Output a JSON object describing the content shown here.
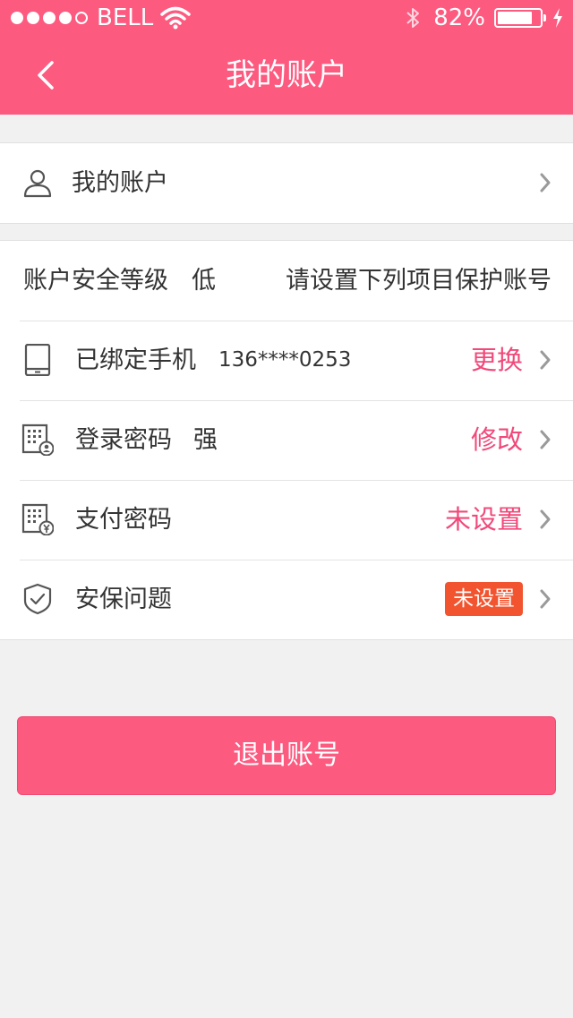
{
  "status_bar": {
    "carrier": "BELL",
    "battery_percent": "82%",
    "battery_level": 0.82
  },
  "nav": {
    "title": "我的账户"
  },
  "account_row": {
    "label": "我的账户"
  },
  "security": {
    "level_label": "账户安全等级",
    "level_value": "低",
    "hint": "请设置下列项目保护账号",
    "items": [
      {
        "label": "已绑定手机",
        "detail": "136****0253",
        "action": "更换"
      },
      {
        "label": "登录密码",
        "detail": "强",
        "action": "修改"
      },
      {
        "label": "支付密码",
        "action": "未设置"
      },
      {
        "label": "安保问题",
        "action": "未设置"
      }
    ]
  },
  "logout": {
    "label": "退出账号"
  },
  "colors": {
    "brand": "#fd5a80",
    "action_text": "#f0497a",
    "warning": "#e4412c",
    "badge": "#f2542f"
  }
}
